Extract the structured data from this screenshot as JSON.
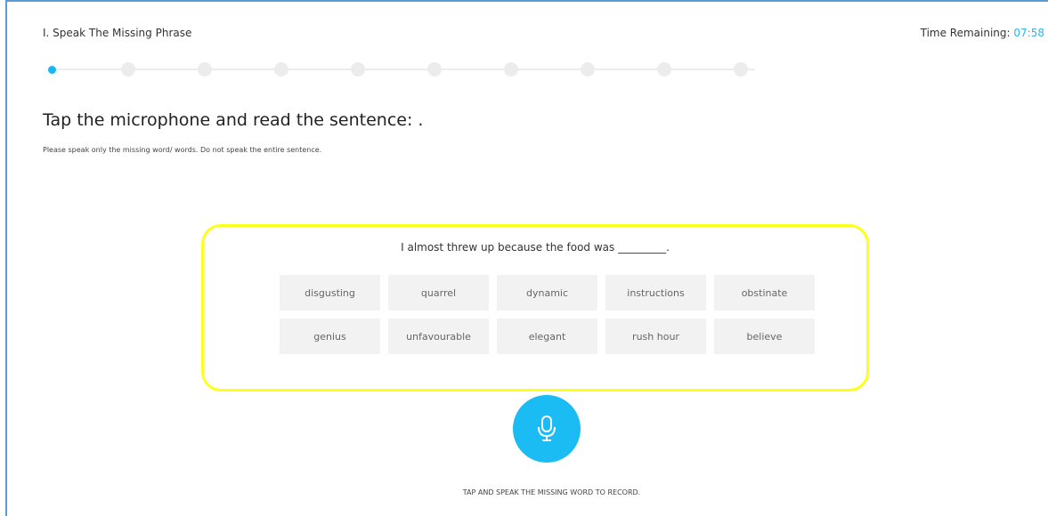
{
  "header": {
    "section_title": "I. Speak The Missing Phrase",
    "timer_label": "Time Remaining:",
    "timer_value": "07:58"
  },
  "progress": {
    "total_steps": 10,
    "current_step": 1
  },
  "prompt": {
    "instruction": "Tap the microphone and read the sentence: .",
    "note": "Please speak only the missing word/ words. Do not speak the entire sentence."
  },
  "question": {
    "sentence": "I almost threw up because the food was _________.",
    "options": [
      "disgusting",
      "quarrel",
      "dynamic",
      "instructions",
      "obstinate",
      "genius",
      "unfavourable",
      "elegant",
      "rush hour",
      "believe"
    ]
  },
  "recorder": {
    "icon": "microphone-icon",
    "hint": "TAP AND SPEAK THE MISSING WORD TO RECORD."
  },
  "colors": {
    "accent": "#1bb5f5",
    "highlight": "#ffff1c",
    "frame": "#5b9bd5"
  }
}
